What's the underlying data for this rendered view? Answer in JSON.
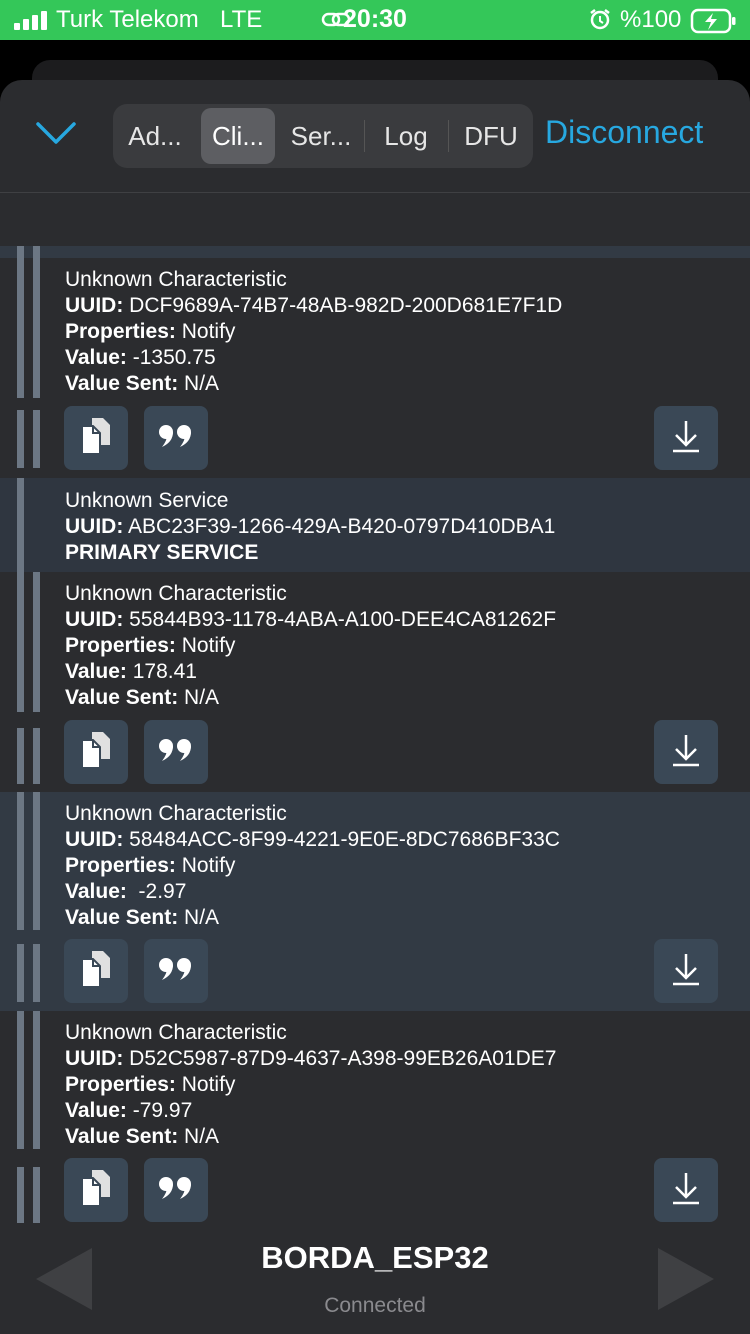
{
  "status_bar": {
    "carrier": "Turk Telekom",
    "network": "LTE",
    "time": "20:30",
    "battery": "%100",
    "icons": [
      "signal-icon",
      "link-icon",
      "alarm-icon",
      "battery-charging-icon"
    ]
  },
  "header": {
    "collapse_icon": "chevron-down-icon",
    "tabs": [
      {
        "label": "Ad..."
      },
      {
        "label": "Cli...",
        "active": true
      },
      {
        "label": "Ser..."
      },
      {
        "label": "Log"
      },
      {
        "label": "DFU"
      }
    ],
    "disconnect_label": "Disconnect",
    "accent_color": "#27a8e0"
  },
  "list": {
    "char1": {
      "title": "Unknown Characteristic",
      "uuid_label": "UUID:",
      "uuid": "DCF9689A-74B7-48AB-982D-200D681E7F1D",
      "properties_label": "Properties:",
      "properties": "Notify",
      "value_label": "Value:",
      "value": "-1350.75",
      "value_sent_label": "Value Sent:",
      "value_sent": "N/A"
    },
    "service": {
      "title": "Unknown Service",
      "uuid_label": "UUID:",
      "uuid": "ABC23F39-1266-429A-B420-0797D410DBA1",
      "type": "PRIMARY SERVICE"
    },
    "char2": {
      "title": "Unknown Characteristic",
      "uuid_label": "UUID:",
      "uuid": "55844B93-1178-4ABA-A100-DEE4CA81262F",
      "properties_label": "Properties:",
      "properties": "Notify",
      "value_label": "Value:",
      "value": "178.41",
      "value_sent_label": "Value Sent:",
      "value_sent": "N/A"
    },
    "char3": {
      "title": "Unknown Characteristic",
      "uuid_label": "UUID:",
      "uuid": "58484ACC-8F99-4221-9E0E-8DC7686BF33C",
      "properties_label": "Properties:",
      "properties": "Notify",
      "value_label": "Value:",
      "value": " -2.97",
      "value_sent_label": "Value Sent:",
      "value_sent": "N/A"
    },
    "char4": {
      "title": "Unknown Characteristic",
      "uuid_label": "UUID:",
      "uuid": "D52C5987-87D9-4637-A398-99EB26A01DE7",
      "properties_label": "Properties:",
      "properties": "Notify",
      "value_label": "Value:",
      "value": "-79.97",
      "value_sent_label": "Value Sent:",
      "value_sent": "N/A"
    },
    "action_icons": [
      "copy-icon",
      "quote-icon",
      "download-icon"
    ]
  },
  "footer": {
    "device_name": "BORDA_ESP32",
    "state": "Connected",
    "icons": [
      "previous-arrow-icon",
      "next-arrow-icon"
    ]
  }
}
